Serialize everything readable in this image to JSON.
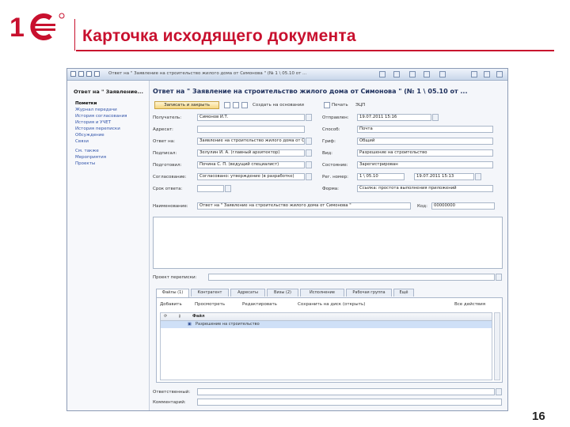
{
  "slide": {
    "title": "Карточка исходящего документа",
    "page_number": "16",
    "brand_color": "#c8102e"
  },
  "window": {
    "title": "Ответ на \" Заявление на строительство жилого дома от Симонова \" (№ 1 \\ 05.10 от ..."
  },
  "sidebar": {
    "header": "Ответ на \" Заявление...",
    "items": [
      {
        "label": "Пометки",
        "active": true
      },
      {
        "label": "Журнал передачи",
        "active": false
      },
      {
        "label": "История согласования",
        "active": false
      },
      {
        "label": "История и УЧЕТ",
        "active": false
      },
      {
        "label": "История переписки",
        "active": false
      },
      {
        "label": "Обсуждение",
        "active": false
      },
      {
        "label": "Связи",
        "active": false
      },
      {
        "label": "См. также",
        "active": false
      },
      {
        "label": "Мероприятия",
        "active": false
      },
      {
        "label": "Проекты",
        "active": false
      }
    ]
  },
  "document": {
    "title": "Ответ на \" Заявление на строительство жилого дома от Симонова \" (№ 1 \\ 05.10 от ...",
    "toolbar": {
      "save_close": "Записать и закрыть",
      "create_basis": "Создать на основании",
      "print": "Печать",
      "esp": "ЭЦП"
    }
  },
  "form": {
    "left": [
      {
        "label": "Получатель:",
        "value": "Симонов И.Т."
      },
      {
        "label": "Адресат:",
        "value": ""
      },
      {
        "label": "Ответ на:",
        "value": "Заявление на строительство жилого дома от Си..."
      },
      {
        "label": "Подписал:",
        "value": "Зелулин И. А. (главный архитектор)"
      },
      {
        "label": "Подготовил:",
        "value": "Почина С. П. (ведущий специалист)"
      },
      {
        "label": "Согласование:",
        "value": "Согласовано: утверждение (в разработке)"
      },
      {
        "label": "Срок ответа:",
        "value": ""
      }
    ],
    "right": [
      {
        "label": "Отправлен:",
        "value": "19.07.2011 15:16"
      },
      {
        "label": "Способ:",
        "value": "Почта"
      },
      {
        "label": "Гриф:",
        "value": "Общий"
      },
      {
        "label": "Вид:",
        "value": "Разрешение на строительство"
      },
      {
        "label": "Состояние:",
        "value": "Зарегистрирован"
      },
      {
        "label": "Рег. номер:",
        "value": "1 \\ 05.10",
        "date": "19.07.2011 15:13"
      },
      {
        "label": "Форма:",
        "value": "Ссылка: простота выполнения приложений"
      }
    ],
    "name_label": "Наименование:",
    "name_value": "Ответ на \" Заявление на строительство жилого дома от Симонова \"",
    "code_label": "Код:",
    "code_value": "00000000",
    "project_label": "Проект переписки:",
    "responsible_label": "Ответственный:",
    "comment_label": "Комментарий:"
  },
  "tabs": [
    {
      "label": "Файлы (1)",
      "active": true
    },
    {
      "label": "Контрагент",
      "active": false
    },
    {
      "label": "Адресаты",
      "active": false
    },
    {
      "label": "Визы (2)",
      "active": false
    },
    {
      "label": "Исполнение",
      "active": false
    },
    {
      "label": "Рабочая группа",
      "active": false
    },
    {
      "label": "Ещё",
      "active": false
    }
  ],
  "files_panel": {
    "add": "Добавить",
    "open": "Просмотреть",
    "edit": "Редактировать",
    "save_to_disk": "Сохранить на диск (открыть)",
    "all_actions": "Все действия",
    "column": "Файл",
    "rows": [
      "Разрешение на строительство"
    ]
  }
}
